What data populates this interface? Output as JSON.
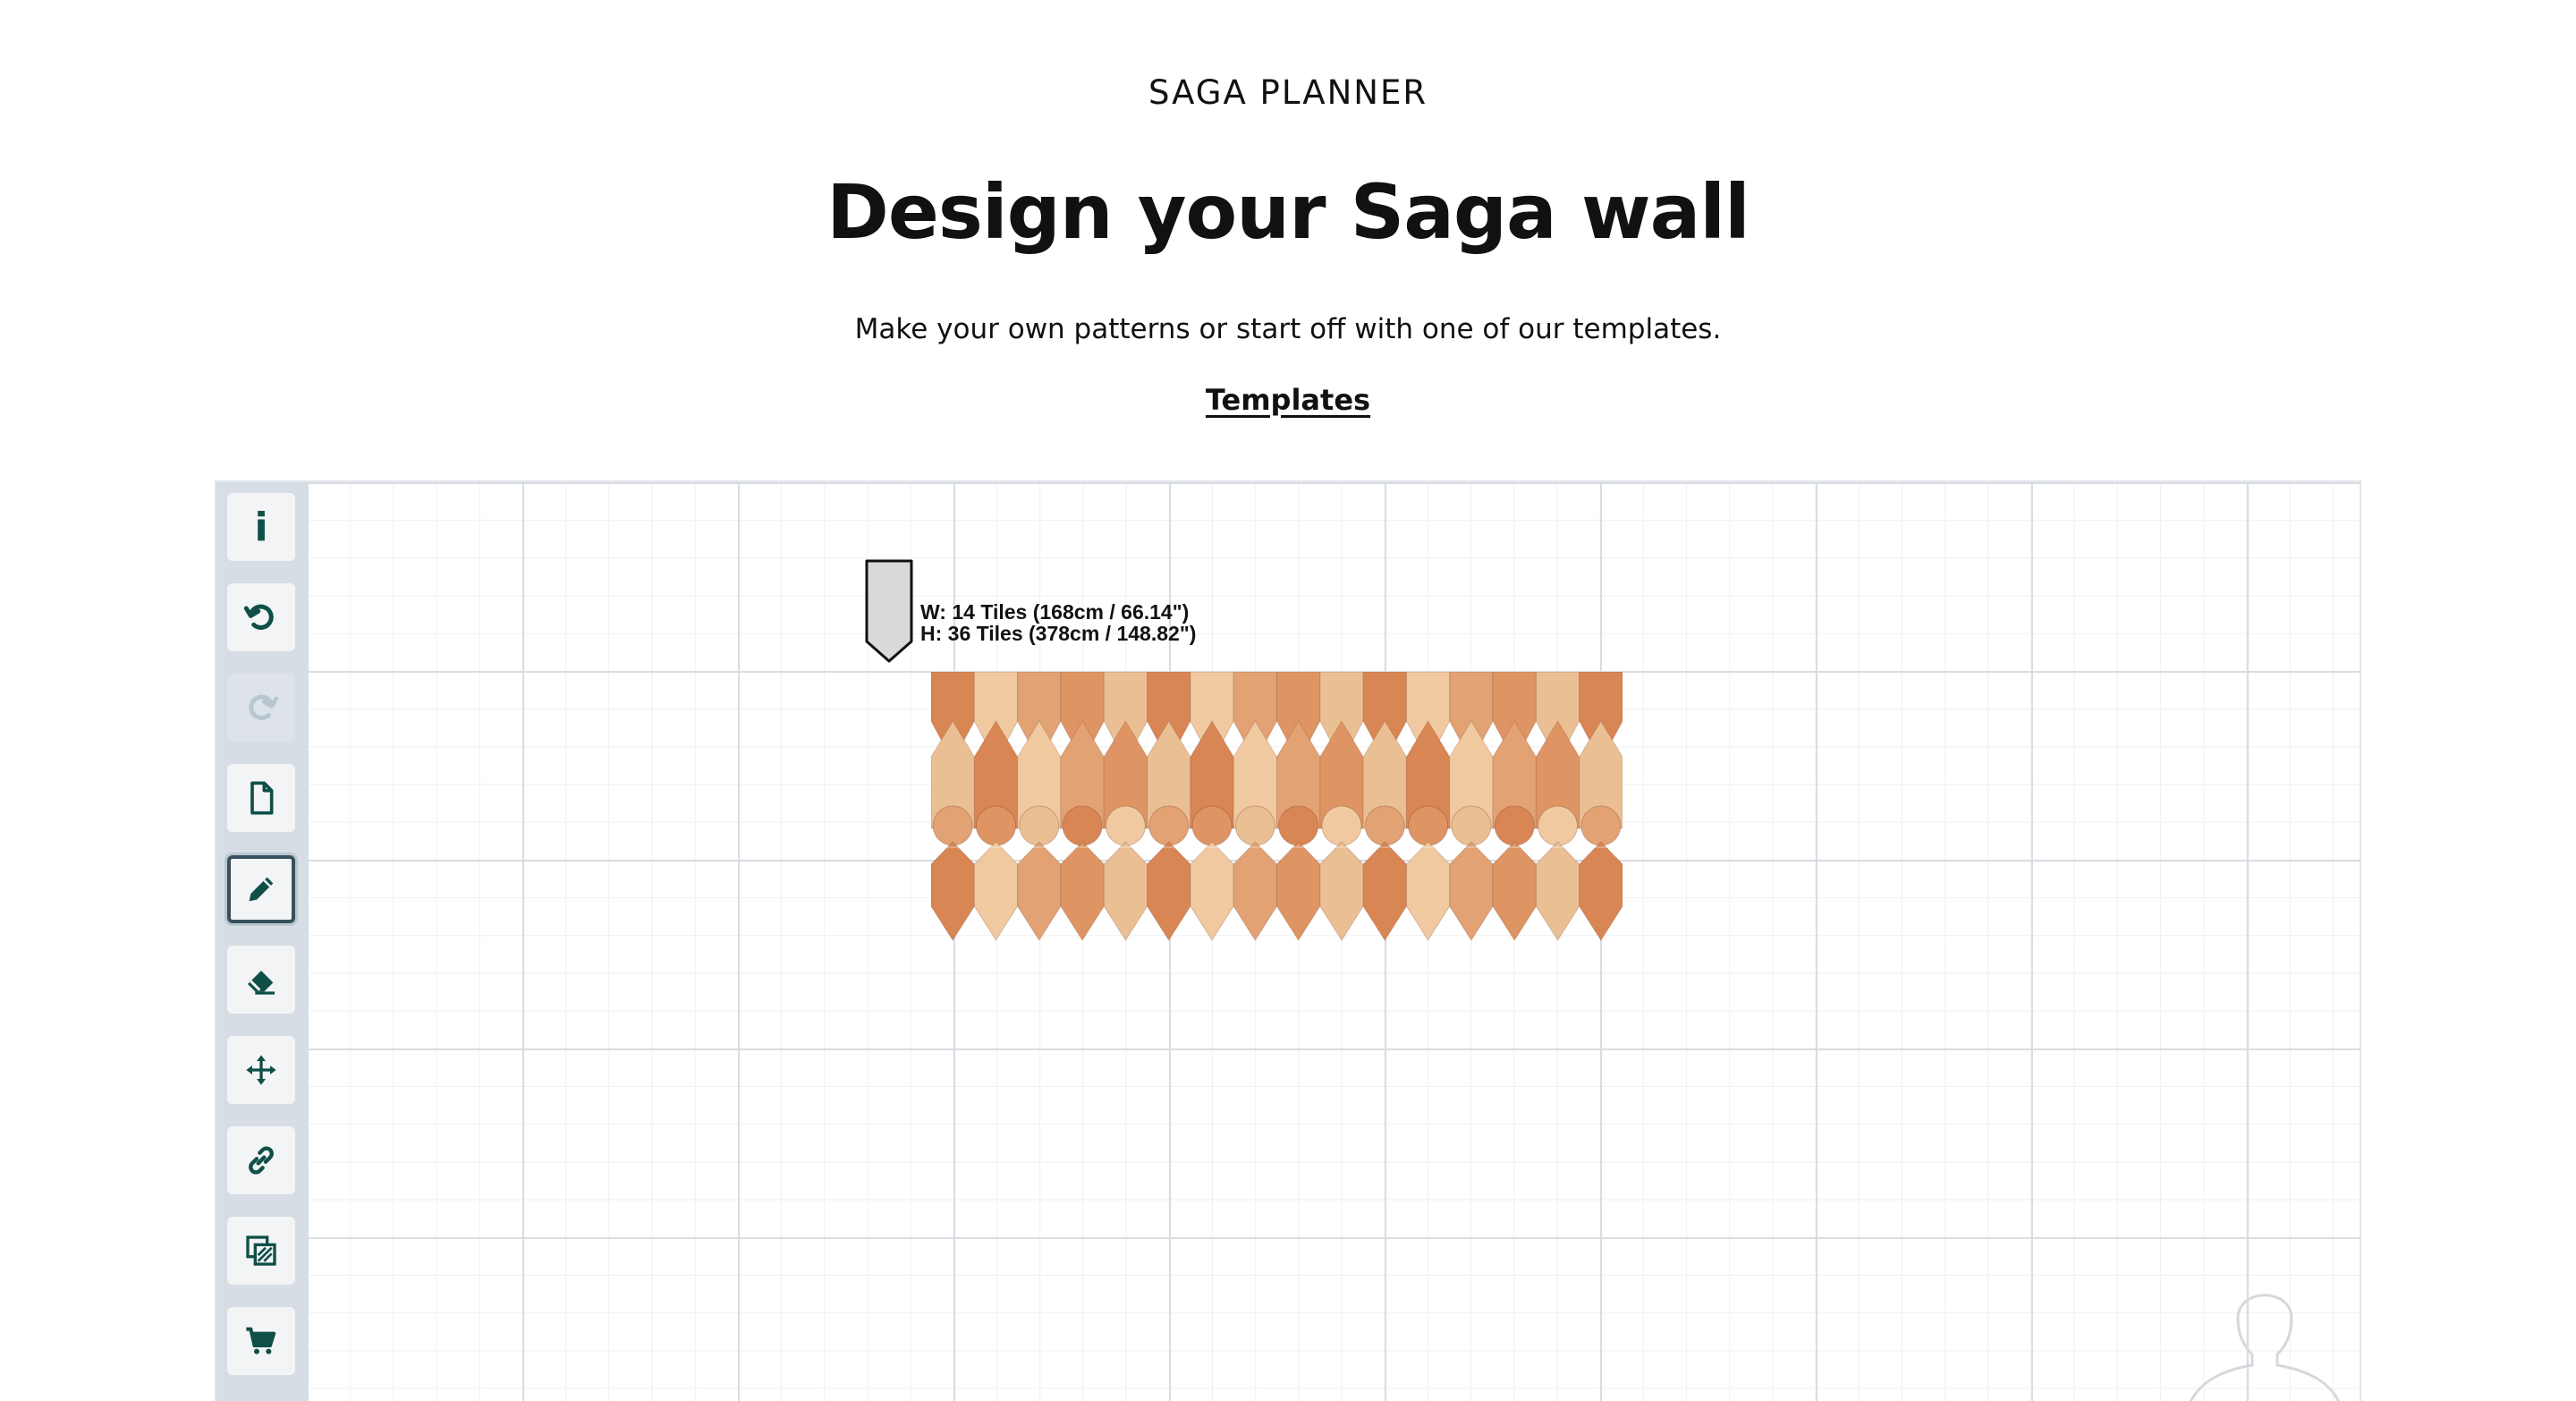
{
  "header": {
    "eyebrow": "SAGA PLANNER",
    "title": "Design your Saga wall",
    "subtitle": "Make your own patterns or start off with one of our templates.",
    "templates_link": "Templates"
  },
  "toolbar": {
    "tools": [
      {
        "name": "info",
        "icon": "info-icon",
        "state": "enabled"
      },
      {
        "name": "undo",
        "icon": "undo-icon",
        "state": "enabled"
      },
      {
        "name": "redo",
        "icon": "redo-icon",
        "state": "disabled"
      },
      {
        "name": "new",
        "icon": "document-icon",
        "state": "enabled"
      },
      {
        "name": "draw",
        "icon": "pencil-icon",
        "state": "active"
      },
      {
        "name": "erase",
        "icon": "eraser-icon",
        "state": "enabled"
      },
      {
        "name": "move",
        "icon": "move-icon",
        "state": "enabled"
      },
      {
        "name": "share",
        "icon": "link-icon",
        "state": "enabled"
      },
      {
        "name": "fill",
        "icon": "fill-pattern-icon",
        "state": "enabled"
      },
      {
        "name": "cart",
        "icon": "cart-icon",
        "state": "enabled"
      }
    ]
  },
  "canvas": {
    "dimensions": {
      "width_line": "W: 14 Tiles (168cm / 66.14\")",
      "height_line": "H: 36 Tiles (378cm / 148.82\")"
    },
    "tile_colors": [
      "#d98655",
      "#e2a274",
      "#ebbf94",
      "#f0c9a0",
      "#de9563"
    ]
  },
  "colors": {
    "accent": "#0f4f47",
    "toolbar_bg": "#d6dde4",
    "active_border": "#36515c"
  }
}
